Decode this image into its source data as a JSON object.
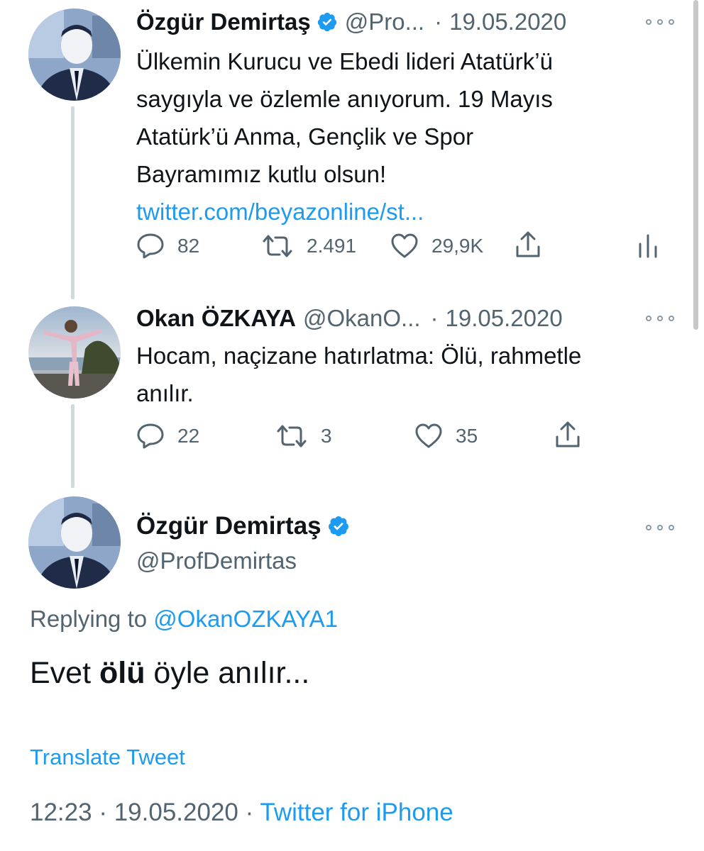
{
  "tweets": [
    {
      "author": "Özgür Demirtaş",
      "handle": "@Pro...",
      "separator": "·",
      "date": "19.05.2020",
      "lines": [
        "Ülkemin Kurucu ve Ebedi lideri Atatürk’ü",
        "saygıyla ve özlemle anıyorum. 19 Mayıs",
        "Atatürk’ü Anma, Gençlik ve Spor",
        "Bayramımız kutlu olsun!"
      ],
      "link": "twitter.com/beyazonline/st...",
      "replies": "82",
      "retweets": "2.491",
      "likes": "29,9K"
    },
    {
      "author": "Okan ÖZKAYA",
      "handle": "@OkanO...",
      "separator": "·",
      "date": "19.05.2020",
      "lines": [
        "Hocam, naçizane hatırlatma: Ölü, rahmetle",
        "anılır."
      ],
      "replies": "22",
      "retweets": "3",
      "likes": "35"
    }
  ],
  "main_tweet": {
    "author": "Özgür Demirtaş",
    "handle": "@ProfDemirtas",
    "replying_prefix": "Replying to",
    "replying_handle": "@OkanOZKAYA1",
    "text_before": "Evet ",
    "text_bold": "ölü",
    "text_after": " öyle anılır...",
    "translate": "Translate Tweet",
    "time": "12:23",
    "separator": "·",
    "date": "19.05.2020",
    "source": "Twitter for iPhone"
  },
  "icons": {
    "reply": "reply-icon",
    "retweet": "retweet-icon",
    "like": "heart-icon",
    "share": "share-icon",
    "analytics": "analytics-icon",
    "verified": "verified-badge-icon",
    "more": "more-icon"
  },
  "colors": {
    "link": "#1d9bf0",
    "secondary": "#536471",
    "thread_line": "#cfd9de"
  }
}
